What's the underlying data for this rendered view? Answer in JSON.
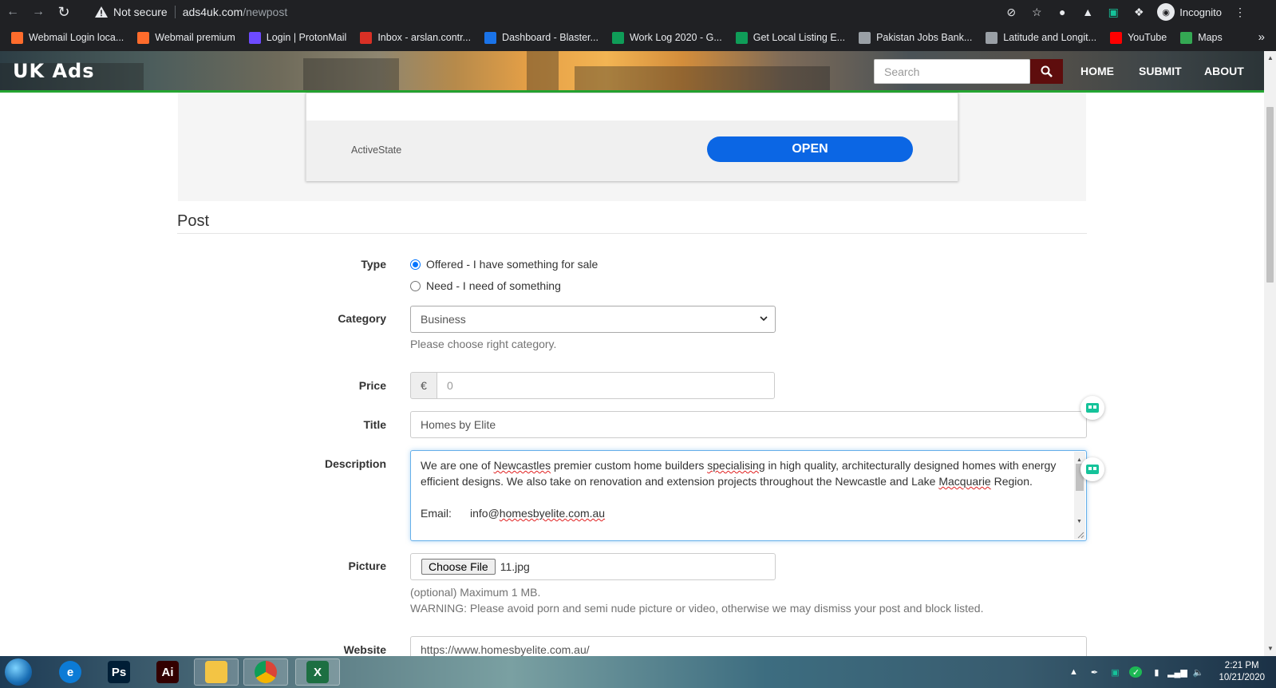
{
  "browser": {
    "not_secure": "Not secure",
    "url_host": "ads4uk.com",
    "url_path": "/newpost",
    "profile": "Incognito"
  },
  "bookmarks": [
    {
      "label": "Webmail Login loca...",
      "icon": "cpanel-icon",
      "color": "#ff6c2c"
    },
    {
      "label": "Webmail premium",
      "icon": "cpanel-icon",
      "color": "#ff6c2c"
    },
    {
      "label": "Login | ProtonMail",
      "icon": "protonmail-icon",
      "color": "#6d4aff"
    },
    {
      "label": "Inbox - arslan.contr...",
      "icon": "gmail-icon",
      "color": "#d93025"
    },
    {
      "label": "Dashboard - Blaster...",
      "icon": "blaster-icon",
      "color": "#1a73e8"
    },
    {
      "label": "Work Log 2020 - G...",
      "icon": "sheets-icon",
      "color": "#0f9d58"
    },
    {
      "label": "Get Local Listing E...",
      "icon": "sheets-icon",
      "color": "#0f9d58"
    },
    {
      "label": "Pakistan Jobs Bank...",
      "icon": "globe-icon",
      "color": "#9aa0a6"
    },
    {
      "label": "Latitude and Longit...",
      "icon": "globe-icon",
      "color": "#9aa0a6"
    },
    {
      "label": "YouTube",
      "icon": "youtube-icon",
      "color": "#ff0000"
    },
    {
      "label": "Maps",
      "icon": "maps-icon",
      "color": "#34a853"
    }
  ],
  "site": {
    "logo": "UK Ads",
    "search_placeholder": "Search",
    "menu": [
      "HOME",
      "SUBMIT",
      "ABOUT"
    ]
  },
  "ad": {
    "advertiser": "ActiveState",
    "cta": "OPEN"
  },
  "form": {
    "heading": "Post",
    "type_label": "Type",
    "type_options": [
      "Offered - I have something for sale",
      "Need - I need of something"
    ],
    "type_selected": 0,
    "category_label": "Category",
    "category_value": "Business",
    "category_help": "Please choose right category.",
    "price_label": "Price",
    "price_addon": "€",
    "price_placeholder": "0",
    "title_label": "Title",
    "title_value": "Homes by Elite",
    "description_label": "Description",
    "description": {
      "p1_a": "We are one of ",
      "p1_w1": "Newcastles",
      "p1_b": " premier custom home builders ",
      "p1_w2": "specialising",
      "p1_c": " in high quality, architecturally designed homes with energy efficient designs. We also take on renovation and extension projects throughout the Newcastle and Lake ",
      "p1_w3": "Macquarie",
      "p1_d": " Region.",
      "email_label": "Email:",
      "email_pre": "info@",
      "email_word": "homesbyelite.com.au"
    },
    "picture_label": "Picture",
    "file_button": "Choose File",
    "file_name": "11.jpg",
    "picture_help": "(optional) Maximum 1 MB.",
    "picture_warning": "WARNING: Please avoid porn and semi nude picture or video, otherwise we may dismiss your post and block listed.",
    "website_label": "Website",
    "website_value": "https://www.homesbyelite.com.au/"
  },
  "taskbar": {
    "apps": [
      {
        "name": "edge-icon",
        "label": "e",
        "color": "#0c7bd6"
      },
      {
        "name": "photoshop-icon",
        "label": "Ps",
        "color": "#001e36"
      },
      {
        "name": "illustrator-icon",
        "label": "Ai",
        "color": "#330000"
      },
      {
        "name": "file-explorer-icon",
        "label": "",
        "color": "#f3c444"
      },
      {
        "name": "chrome-icon",
        "label": "",
        "color": "#4285f4"
      },
      {
        "name": "excel-icon",
        "label": "X",
        "color": "#1d6f42"
      }
    ],
    "time": "2:21 PM",
    "date": "10/21/2020"
  }
}
